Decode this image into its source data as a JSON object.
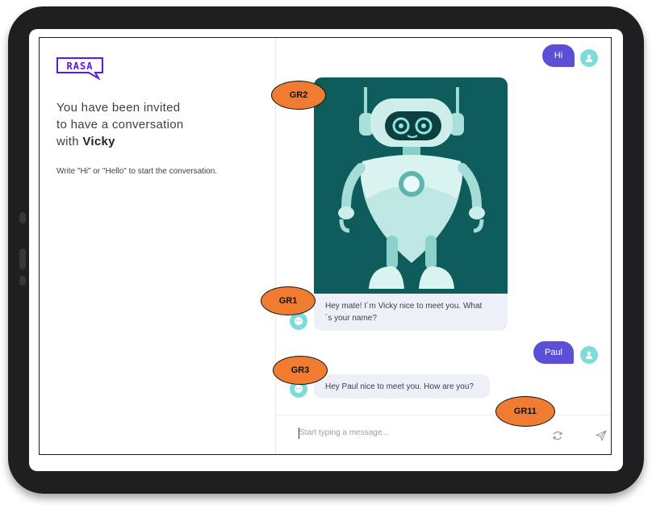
{
  "sidebar": {
    "logo_text": "RASA",
    "invite_line1": "You have been invited",
    "invite_line2": "to have a conversation",
    "invite_line3_prefix": "with ",
    "bot_name": "Vicky",
    "hint": "Write \"Hi\" or \"Hello\" to start the conversation."
  },
  "chat": {
    "messages": [
      {
        "sender": "user",
        "text": "Hi"
      },
      {
        "sender": "bot",
        "type": "image",
        "description": "robot"
      },
      {
        "sender": "bot",
        "text": "Hey mate! I´m Vicky nice to meet you. What ´s your name?",
        "line1": "Hey mate! I´m Vicky nice to meet you. What",
        "line2": "´s your name?"
      },
      {
        "sender": "user",
        "text": "Paul"
      },
      {
        "sender": "bot",
        "text": "Hey Paul nice to meet you. How are you?"
      }
    ],
    "input_placeholder": "Start typing a message...",
    "icons": [
      "user-avatar-icon",
      "bot-avatar-icon",
      "refresh-icon",
      "send-icon"
    ]
  },
  "annotations": [
    "GR2",
    "GR1",
    "GR3",
    "GR11"
  ],
  "colors": {
    "accent": "#5a4fd6",
    "logo": "#5a17ee",
    "avatar": "#7fdbd9",
    "bot_bubble": "#eef0f7",
    "robot_background": "#0e5c5c",
    "annotation": "#f07c32"
  }
}
